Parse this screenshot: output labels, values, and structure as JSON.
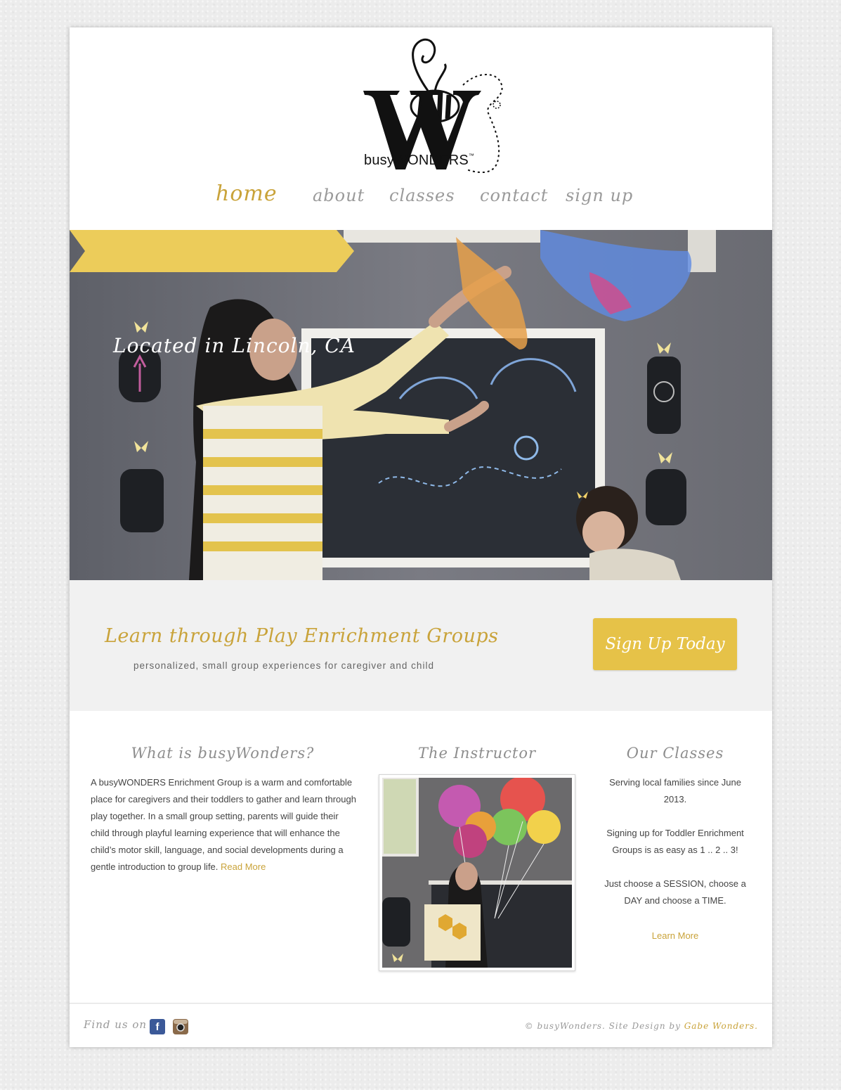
{
  "brand": {
    "logo_text": "busyWONDERS",
    "accent": "#c9a33a",
    "button_yellow": "#e6c248"
  },
  "nav": {
    "items": [
      "home",
      "about",
      "classes",
      "contact",
      "sign up"
    ],
    "active": "home"
  },
  "hero": {
    "banner": "Located in Lincoln, CA"
  },
  "cta_band": {
    "title": "Learn through Play Enrichment Groups",
    "subtitle": "personalized, small group experiences for caregiver and child",
    "button": "Sign Up Today"
  },
  "about": {
    "heading": "What is busyWonders?",
    "body": "A busyWONDERS Enrichment Group is a warm and comfortable place for caregivers and their toddlers to gather and learn through play together. In a small group setting, parents will guide their child through playful learning experience that will enhance the child’s motor skill, language, and social developments during a gentle introduction to group life.",
    "link": "Read More"
  },
  "instructor": {
    "heading": "The Instructor"
  },
  "classes": {
    "heading": "Our Classes",
    "p1": "Serving local families since June 2013.",
    "p2": "Signing up for Toddler Enrichment Groups is as easy as 1 .. 2 .. 3!",
    "p3": "Just choose a SESSION, choose a DAY and choose a TIME.",
    "link": "Learn More"
  },
  "footer": {
    "find_us": "Find us on",
    "social_icons": [
      "facebook-icon",
      "instagram-icon"
    ],
    "credit_prefix": "© busyWonders. Site Design by",
    "credit_name": "Gabe Wonders."
  }
}
